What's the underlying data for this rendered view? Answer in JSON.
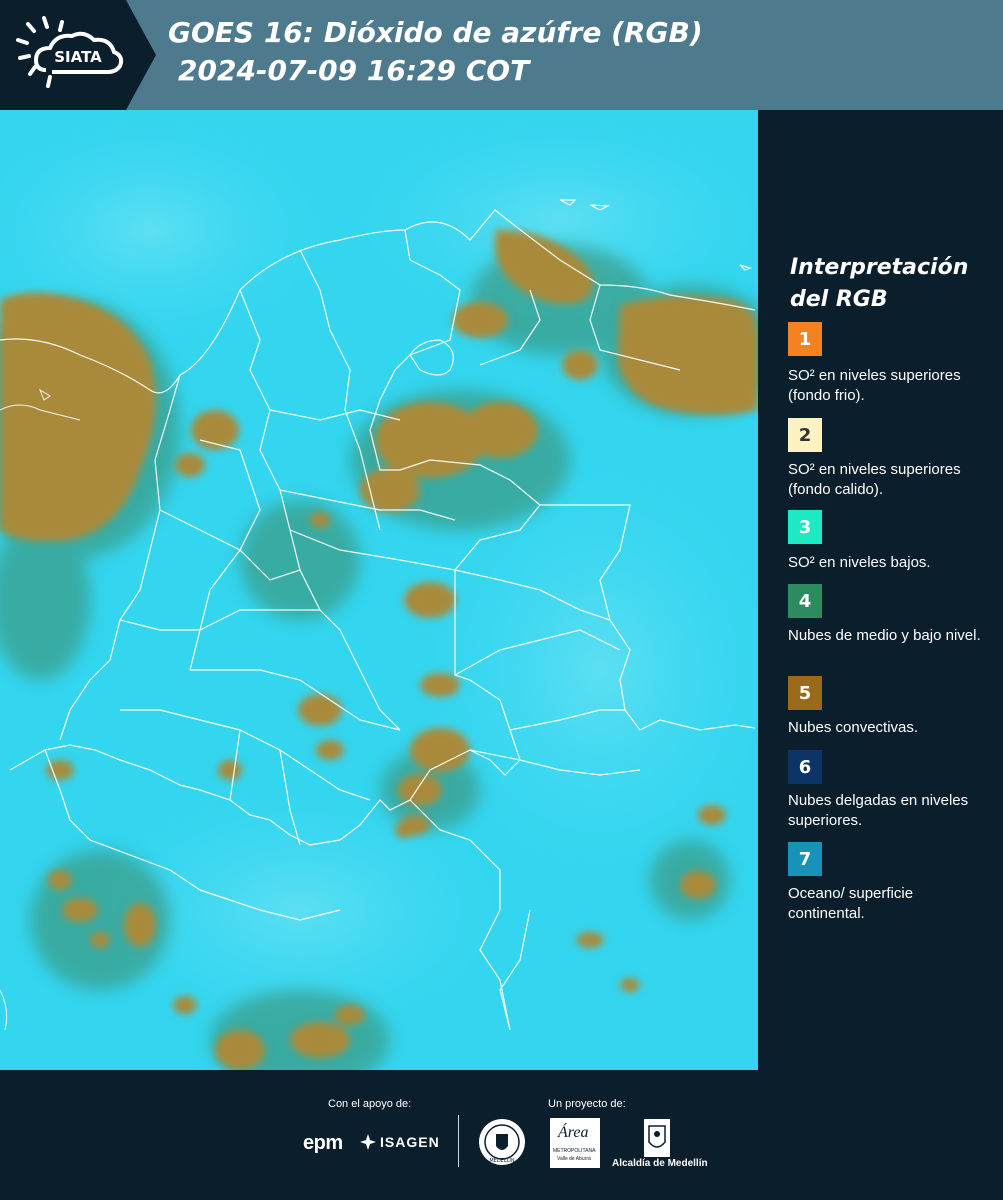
{
  "header": {
    "logo_text": "SIATA",
    "title_line1": "GOES 16: Dióxido de azúfre (RGB)",
    "title_line2": "2024-07-09 16:29 COT",
    "background_color": "#4e7a8e"
  },
  "map": {
    "background_color": "#33d5ef",
    "cloud_color": "#a98a3a",
    "border_color": "#ffffff"
  },
  "legend": {
    "title": "Interpretación del RGB",
    "items": [
      {
        "number": "1",
        "label": "SO² en niveles superiores (fondo frio).",
        "color": "#f58220"
      },
      {
        "number": "2",
        "label": "SO² en niveles superiores (fondo calido).",
        "color": "#fff2c2"
      },
      {
        "number": "3",
        "label": "SO² en niveles bajos.",
        "color": "#1de9c2"
      },
      {
        "number": "4",
        "label": "Nubes de medio y bajo nivel.",
        "color": "#2e8b5f"
      },
      {
        "number": "5",
        "label": "Nubes convectivas.",
        "color": "#9a6a1a"
      },
      {
        "number": "6",
        "label": "Nubes delgadas en niveles superiores.",
        "color": "#0d3466"
      },
      {
        "number": "7",
        "label": "Oceano/ superficie continental.",
        "color": "#1792b8"
      }
    ]
  },
  "footer": {
    "support_label": "Con el apoyo de:",
    "project_label": "Un proyecto de:",
    "sponsor_logos": [
      "epm",
      "ISAGEN"
    ],
    "project_logos": [
      "Área Metropolitana Valle de Aburrá",
      "Alcaldía de Medellín"
    ],
    "amva_logo_text": "Área",
    "amva_sub": "METROPOLITANA",
    "amva_sub2": "Valle de Aburrá",
    "alcaldia_text": "Alcaldía de Medellín",
    "medellin_seal_text": "MEDELLÍN"
  }
}
